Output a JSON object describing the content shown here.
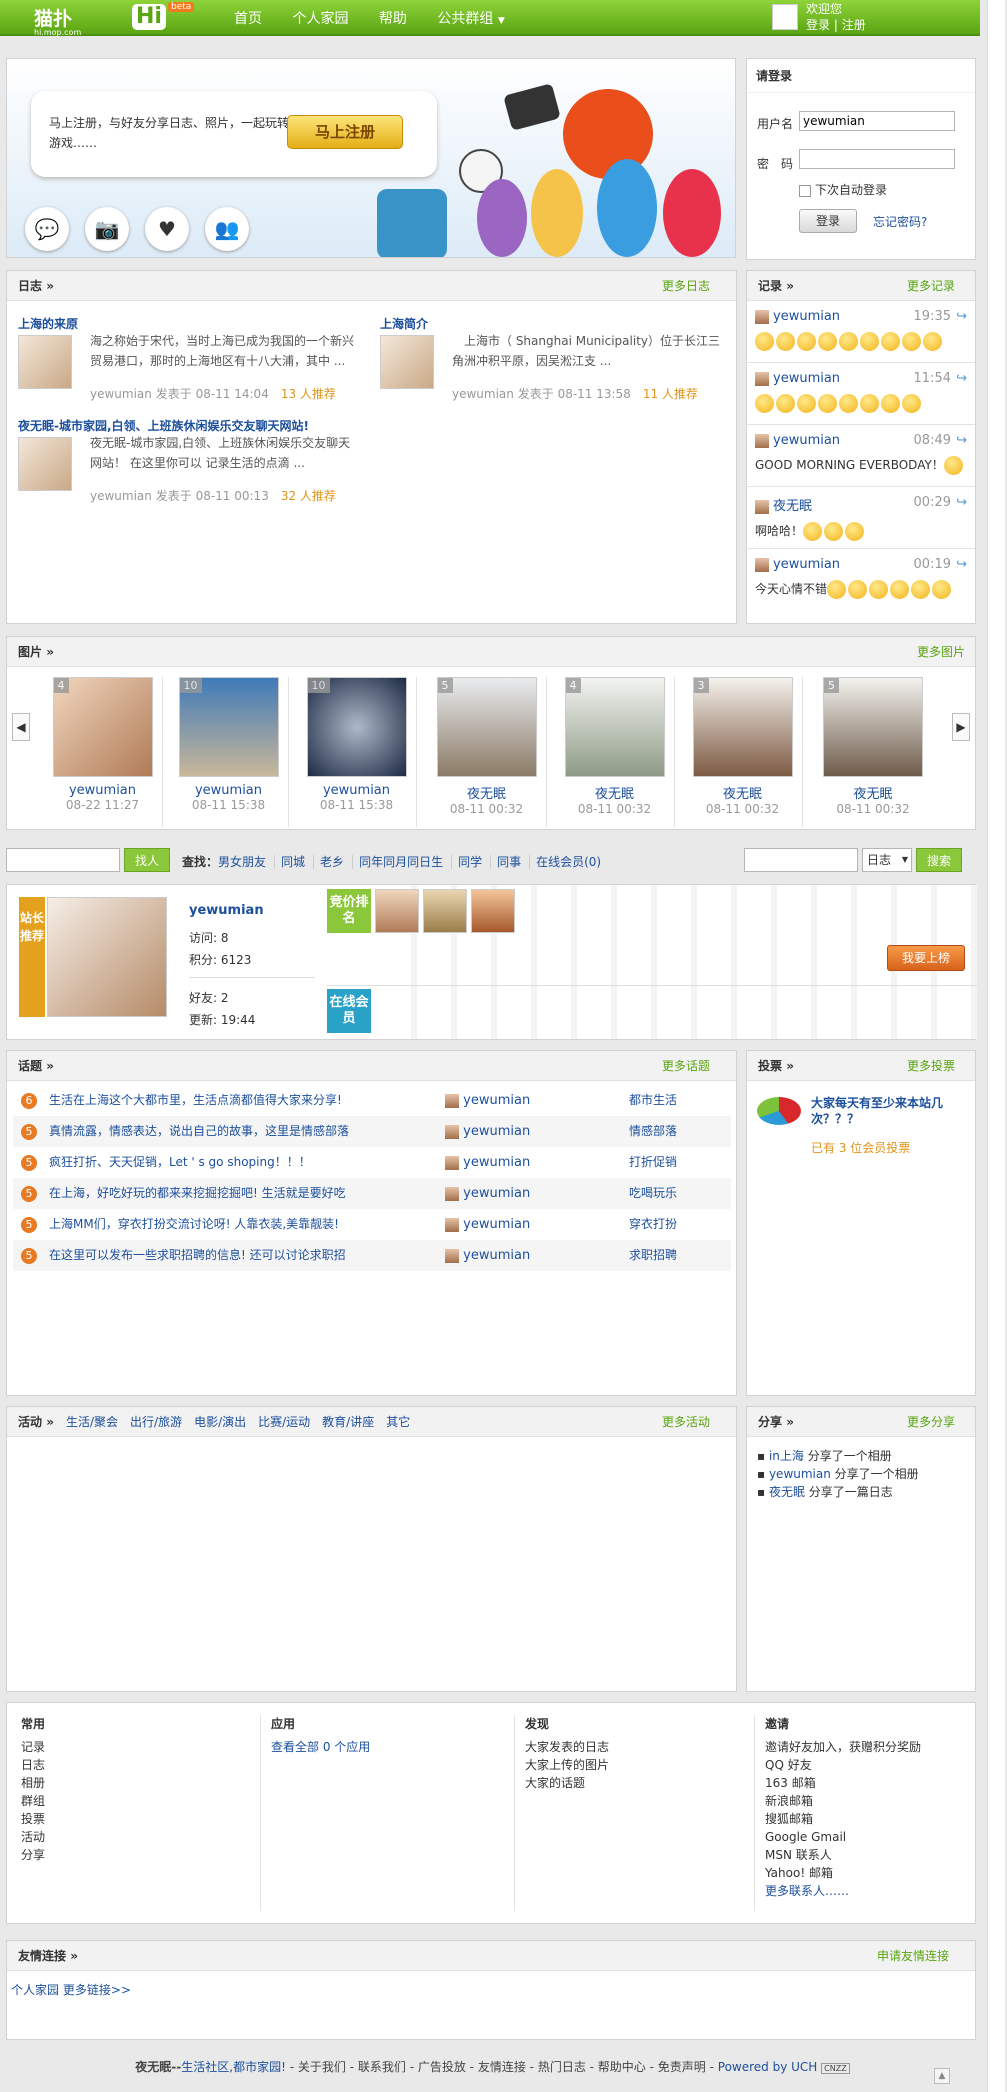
{
  "header": {
    "logo": "猫扑",
    "domain": "hi.mop.com",
    "hi": "Hi",
    "beta": "beta",
    "nav": [
      "首页",
      "个人家园",
      "帮助",
      "公共群组"
    ],
    "welcome": "欢迎您",
    "login_link": "登录",
    "register_link": "注册"
  },
  "banner": {
    "text": "马上注册，与好友分享日志、照片，一起玩转游戏……",
    "button": "马上注册"
  },
  "login": {
    "title": "请登录",
    "user_label": "用户名",
    "user_value": "yewumian",
    "pass_label": "密　码",
    "remember": "下次自动登录",
    "submit": "登录",
    "forgot": "忘记密码?"
  },
  "diary": {
    "title": "日志",
    "more": "更多日志",
    "items": [
      {
        "title": "上海的来原",
        "desc": "海之称始于宋代，当时上海已成为我国的一个新兴贸易港口，那时的上海地区有十八大浦，其中 ...",
        "author": "yewumian",
        "posted": "发表于",
        "date": "08-11 14:04",
        "rec": "13 人推荐"
      },
      {
        "title": "上海简介",
        "desc": "　上海市（ Shanghai Municipality）位于长江三角洲冲积平原，因吴淞江支 ...",
        "author": "yewumian",
        "posted": "发表于",
        "date": "08-11 13:58",
        "rec": "11 人推荐"
      },
      {
        "title": "夜无眠-城市家园,白领、上班族休闲娱乐交友聊天网站!",
        "desc": "夜无眠-城市家园,白领、上班族休闲娱乐交友聊天网站！ 在这里你可以 记录生活的点滴 ...",
        "author": "yewumian",
        "posted": "发表于",
        "date": "08-11 00:13",
        "rec": "32 人推荐"
      }
    ]
  },
  "records": {
    "title": "记录",
    "more": "更多记录",
    "items": [
      {
        "user": "yewumian",
        "time": "19:35",
        "text": ""
      },
      {
        "user": "yewumian",
        "time": "11:54",
        "text": ""
      },
      {
        "user": "yewumian",
        "time": "08:49",
        "text": "GOOD MORNING EVERBODAY！"
      },
      {
        "user": "夜无眠",
        "time": "00:29",
        "text": "啊哈哈！"
      },
      {
        "user": "yewumian",
        "time": "00:19",
        "text": "今天心情不错"
      }
    ]
  },
  "photos": {
    "title": "图片",
    "more": "更多图片",
    "items": [
      {
        "num": "4",
        "user": "yewumian",
        "date": "08-22 11:27"
      },
      {
        "num": "10",
        "user": "yewumian",
        "date": "08-11 15:38"
      },
      {
        "num": "10",
        "user": "yewumian",
        "date": "08-11 15:38"
      },
      {
        "num": "5",
        "user": "夜无眠",
        "date": "08-11 00:32"
      },
      {
        "num": "4",
        "user": "夜无眠",
        "date": "08-11 00:32"
      },
      {
        "num": "3",
        "user": "夜无眠",
        "date": "08-11 00:32"
      },
      {
        "num": "5",
        "user": "夜无眠",
        "date": "08-11 00:32"
      }
    ]
  },
  "search": {
    "find_btn": "找人",
    "label": "查找：",
    "links": [
      "男女朋友",
      "同城",
      "老乡",
      "同年同月同日生",
      "同学",
      "同事",
      "在线会员(0)"
    ],
    "select": "日志",
    "search_btn": "搜索"
  },
  "star": {
    "tag1": "站长推荐",
    "name": "yewumian",
    "visits": "访问: 8",
    "points": "积分: 6123",
    "friends": "好友: 2",
    "updated": "更新: 19:44",
    "rank_tag": "竞价排名",
    "online_tag": "在线会员",
    "rank_btn": "我要上榜"
  },
  "topics": {
    "title": "话题",
    "more": "更多话题",
    "items": [
      {
        "n": "6",
        "title": "生活在上海这个大都市里，生活点滴都值得大家来分享!",
        "user": "yewumian",
        "cat": "都市生活"
      },
      {
        "n": "5",
        "title": "真情流露，情感表达，说出自己的故事，这里是情感部落",
        "user": "yewumian",
        "cat": "情感部落"
      },
      {
        "n": "5",
        "title": "疯狂打折、天天促销，Let ' s go shoping！！！",
        "user": "yewumian",
        "cat": "打折促销"
      },
      {
        "n": "5",
        "title": "在上海，好吃好玩的都来来挖掘挖掘吧! 生活就是要好吃",
        "user": "yewumian",
        "cat": "吃喝玩乐"
      },
      {
        "n": "5",
        "title": "上海MM们，穿衣打扮交流讨论呀! 人靠衣装,美靠靓装!",
        "user": "yewumian",
        "cat": "穿衣打扮"
      },
      {
        "n": "5",
        "title": "在这里可以发布一些求职招聘的信息! 还可以讨论求职招",
        "user": "yewumian",
        "cat": "求职招聘"
      }
    ]
  },
  "vote": {
    "title": "投票",
    "more": "更多投票",
    "question": "大家每天有至少来本站几次？？？",
    "count": "已有  3 位会员投票"
  },
  "activity": {
    "title": "活动",
    "more": "更多活动",
    "cats": [
      "生活/聚会",
      "出行/旅游",
      "电影/演出",
      "比赛/运动",
      "教育/讲座",
      "其它"
    ]
  },
  "share": {
    "title": "分享",
    "more": "更多分享",
    "items": [
      {
        "user": "in上海",
        "text": " 分享了一个相册"
      },
      {
        "user": "yewumian",
        "text": " 分享了一个相册"
      },
      {
        "user": "夜无眠",
        "text": " 分享了一篇日志"
      }
    ]
  },
  "footer": {
    "common": {
      "title": "常用",
      "items": [
        "记录",
        "日志",
        "相册",
        "群组",
        "投票",
        "活动",
        "分享"
      ]
    },
    "apps": {
      "title": "应用",
      "items": [
        "查看全部  0 个应用"
      ]
    },
    "discover": {
      "title": "发现",
      "items": [
        "大家发表的日志",
        "大家上传的图片",
        "大家的话题"
      ]
    },
    "invite": {
      "title": "邀请",
      "items": [
        "邀请好友加入，获赠积分奖励",
        "QQ 好友",
        "163 邮箱",
        "新浪邮箱",
        "搜狐邮箱",
        "Google Gmail",
        "MSN 联系人",
        "Yahoo! 邮箱",
        "更多联系人……"
      ]
    }
  },
  "links": {
    "title": "友情连接",
    "more": "申请友情连接",
    "items": [
      "个人家园",
      "更多链接>>"
    ]
  },
  "bottom": {
    "site": "夜无眠--",
    "slogan": "生活社区,都市家园!",
    "items": [
      "关于我们",
      "联系我们",
      "广告投放",
      "友情连接",
      "热门日志",
      "帮助中心",
      "免责声明"
    ],
    "powered": "Powered by UCH",
    "cnzz": "CNZZ"
  }
}
